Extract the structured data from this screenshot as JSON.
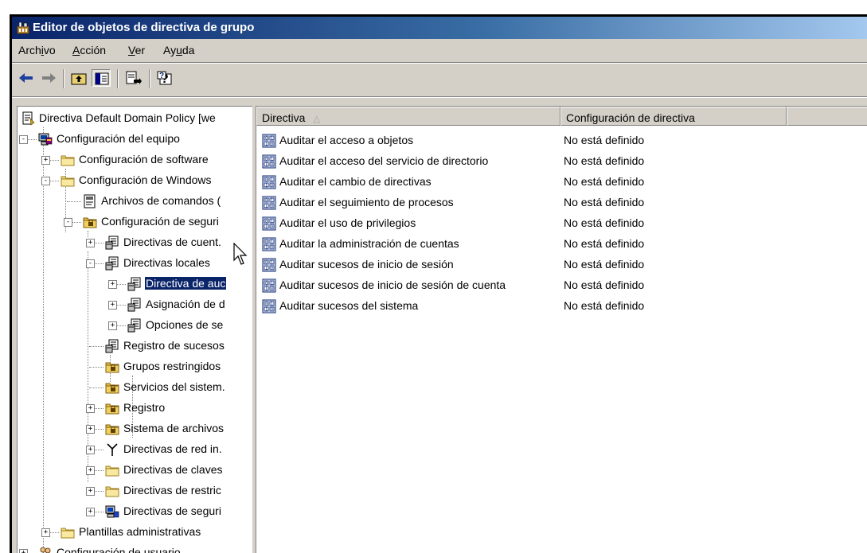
{
  "window": {
    "title": "Editor de objetos de directiva de grupo"
  },
  "menu": [
    {
      "label": "Archivo",
      "mnemonic_index": 4
    },
    {
      "label": "Acción",
      "mnemonic_index": 0
    },
    {
      "label": "Ver",
      "mnemonic_index": 0
    },
    {
      "label": "Ayuda",
      "mnemonic_index": 2
    }
  ],
  "toolbar": {
    "buttons": [
      "back-arrow-icon",
      "forward-arrow-icon",
      "up-folder-icon",
      "show-hide-tree-icon",
      "export-list-icon",
      "help-icon"
    ]
  },
  "tree": {
    "root": "Directiva Default Domain Policy [we",
    "equipo": "Configuración del equipo",
    "software": "Configuración de software",
    "windows": "Configuración de Windows",
    "scripts": "Archivos de comandos (",
    "seguridad": "Configuración de seguri",
    "cuentas": "Directivas de cuent.",
    "locales": "Directivas locales",
    "auditoria": "Directiva de auc",
    "asignacion": "Asignación de d",
    "opciones": "Opciones de se",
    "registro_sucesos": "Registro de sucesos",
    "grupos": "Grupos restringidos",
    "servicios": "Servicios del sistem.",
    "registro": "Registro",
    "archivos": "Sistema de archivos",
    "red": "Directivas de red in.",
    "claves": "Directivas de claves",
    "restric": "Directivas de restric",
    "segip": "Directivas de seguri",
    "plantillas": "Plantillas administrativas",
    "usuario": "Configuración de usuario"
  },
  "list": {
    "columns": [
      "Directiva",
      "Configuración de directiva"
    ],
    "rows": [
      {
        "name": "Auditar el acceso a objetos",
        "value": "No está definido"
      },
      {
        "name": "Auditar el acceso del servicio de directorio",
        "value": "No está definido"
      },
      {
        "name": "Auditar el cambio de directivas",
        "value": "No está definido"
      },
      {
        "name": "Auditar el seguimiento de procesos",
        "value": "No está definido"
      },
      {
        "name": "Auditar el uso de privilegios",
        "value": "No está definido"
      },
      {
        "name": "Auditar la administración de cuentas",
        "value": "No está definido"
      },
      {
        "name": "Auditar sucesos de inicio de sesión",
        "value": "No está definido"
      },
      {
        "name": "Auditar sucesos de inicio de sesión de cuenta",
        "value": "No está definido"
      },
      {
        "name": "Auditar sucesos del sistema",
        "value": "No está definido"
      }
    ]
  },
  "colors": {
    "title_start": "#0a246a",
    "title_end": "#a6caf0",
    "selection": "#0a246a",
    "face": "#d4d0c8"
  }
}
